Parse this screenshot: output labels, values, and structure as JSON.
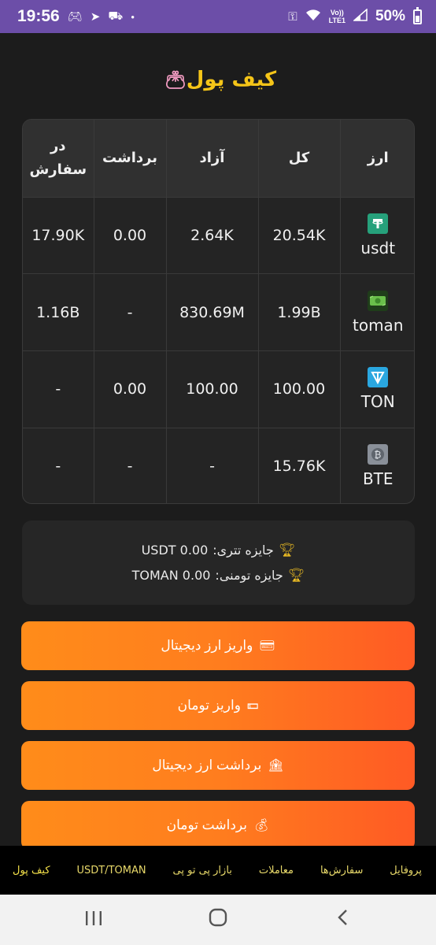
{
  "status_bar": {
    "time": "19:56",
    "battery": "50%",
    "battery_level": 0.5,
    "volte_top": "Vo))",
    "volte_bottom": "LTE1"
  },
  "page": {
    "title": "کیف پول"
  },
  "table": {
    "headers": [
      "ارز",
      "کل",
      "آزاد",
      "برداشت",
      "در سفارش"
    ],
    "rows": [
      {
        "currency": "usdt",
        "icon": "tether-icon",
        "icon_color": "#26a17b",
        "total": "20.54K",
        "free": "2.64K",
        "withdraw": "0.00",
        "in_order": "17.90K"
      },
      {
        "currency": "toman",
        "icon": "banknote-icon",
        "icon_color": "#6abf4b",
        "total": "1.99B",
        "free": "830.69M",
        "withdraw": "-",
        "in_order": "1.16B"
      },
      {
        "currency": "TON",
        "icon": "ton-icon",
        "icon_color": "#2aa7e0",
        "total": "100.00",
        "free": "100.00",
        "withdraw": "0.00",
        "in_order": "-"
      },
      {
        "currency": "BTE",
        "icon": "bitcoin-icon",
        "icon_color": "#8a9099",
        "total": "15.76K",
        "free": "-",
        "withdraw": "-",
        "in_order": "-"
      }
    ]
  },
  "prizes": {
    "usdt_label": "جایزه تتری:",
    "usdt_value": "USDT 0.00",
    "toman_label": "جایزه تومنی:",
    "toman_value": "TOMAN 0.00"
  },
  "actions": {
    "deposit_crypto": "واریز ارز دیجیتال",
    "deposit_toman": "واریز تومان",
    "withdraw_crypto": "برداشت ارز دیجیتال",
    "withdraw_toman": "برداشت تومان"
  },
  "bottom_nav": {
    "items": [
      "پروفایل",
      "سفارش‌ها",
      "معاملات",
      "بازار پی تو پی",
      "USDT/TOMAN",
      "کیف پول"
    ]
  },
  "colors": {
    "title": "#f5c518",
    "nav_text": "#e8d96a",
    "button_gradient_start": "#ff8c1a",
    "button_gradient_end": "#ff5a24",
    "status_bar": "#6c4ea8"
  }
}
